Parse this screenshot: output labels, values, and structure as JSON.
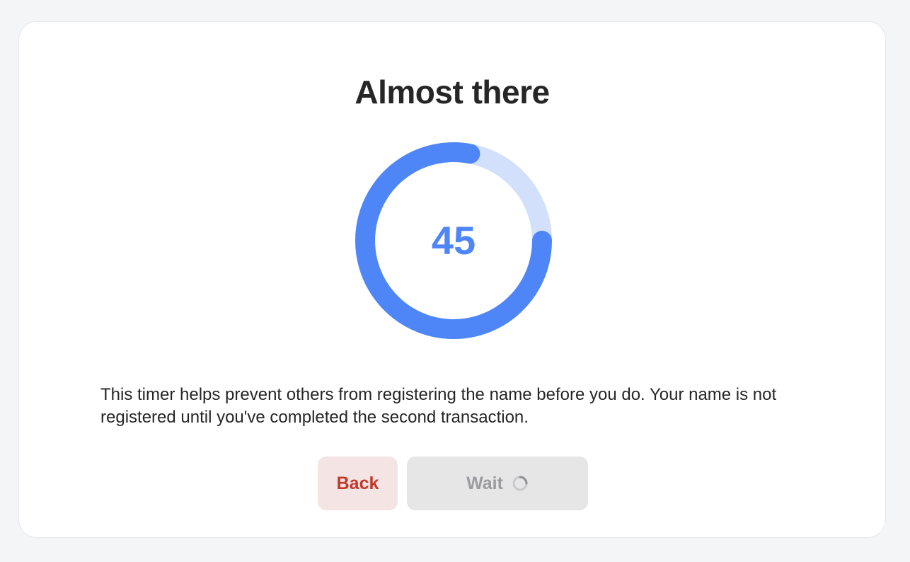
{
  "title": "Almost there",
  "timer": {
    "seconds_remaining": "45",
    "progress_fraction": 0.78,
    "colors": {
      "track": "#d3e0fb",
      "progress": "#4f86f7",
      "number": "#4f86f7"
    }
  },
  "description": "This timer helps prevent others from registering the name before you do. Your name is not registered until you've completed the second transaction.",
  "buttons": {
    "back_label": "Back",
    "wait_label": "Wait"
  },
  "colors": {
    "back_text": "#c0392b",
    "back_bg": "#f5e4e4",
    "wait_text": "#9b9ba0",
    "wait_bg": "#e6e6e7"
  },
  "icons": {
    "wait_spinner": "spinner-icon"
  }
}
